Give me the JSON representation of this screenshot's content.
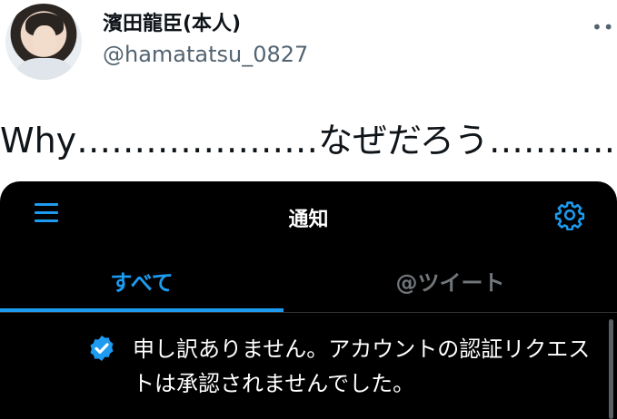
{
  "tweet": {
    "display_name": "濱田龍臣(本人)",
    "handle": "@hamatatsu_0827",
    "more_icon": "•••",
    "text": "Why…………………なぜだろう…………"
  },
  "embedded_screenshot": {
    "header": {
      "title": "通知",
      "menu_icon": "hamburger-icon",
      "settings_icon": "gear-icon"
    },
    "tabs": [
      {
        "label": "すべて",
        "active": true
      },
      {
        "label": "@ツイート",
        "active": false
      }
    ],
    "notification": {
      "icon": "verified-badge-icon",
      "text": "申し訳ありません。アカウントの認証リクエストは承認されませんでした。"
    },
    "colors": {
      "accent": "#1d9bf0",
      "background": "#000000",
      "muted": "#71767b"
    }
  }
}
